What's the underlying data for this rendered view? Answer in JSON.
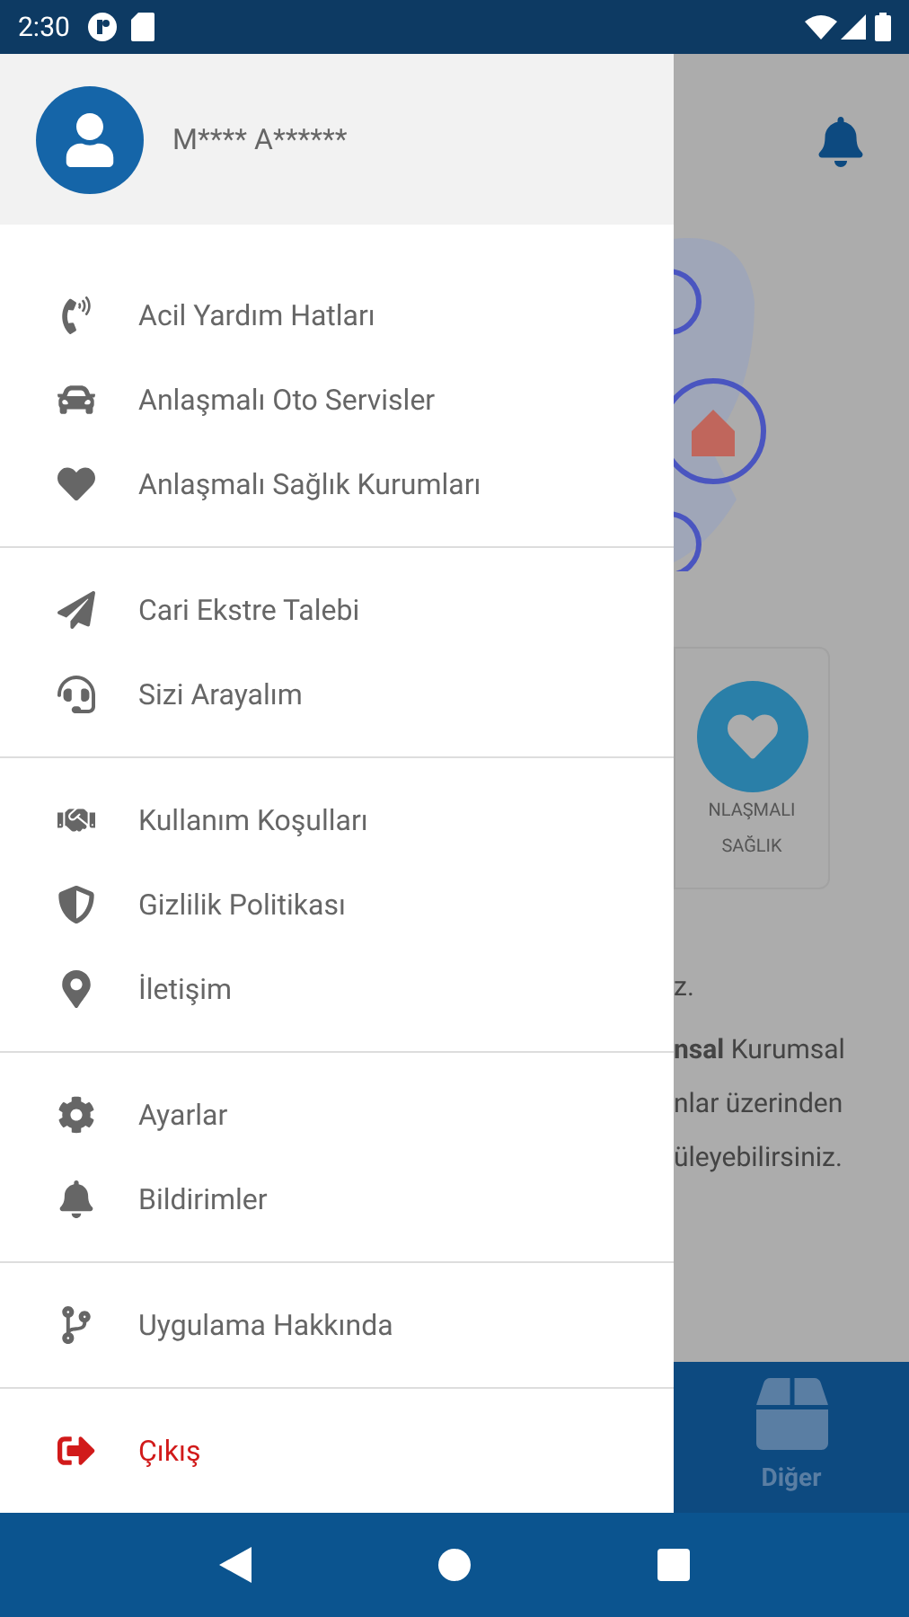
{
  "status_bar": {
    "time": "2:30"
  },
  "user": {
    "name": "M**** A******"
  },
  "menu_groups": [
    {
      "items": [
        {
          "label": "Acil Yardım Hatları",
          "kind": "normal"
        },
        {
          "label": "Anlaşmalı Oto Servisler",
          "kind": "normal"
        },
        {
          "label": "Anlaşmalı Sağlık Kurumları",
          "kind": "normal"
        }
      ]
    },
    {
      "items": [
        {
          "label": "Cari Ekstre Talebi",
          "kind": "normal"
        },
        {
          "label": "Sizi Arayalım",
          "kind": "normal"
        }
      ]
    },
    {
      "items": [
        {
          "label": "Kullanım Koşulları",
          "kind": "normal"
        },
        {
          "label": "Gizlilik Politikası",
          "kind": "normal"
        },
        {
          "label": "İletişim",
          "kind": "normal"
        }
      ]
    },
    {
      "items": [
        {
          "label": "Ayarlar",
          "kind": "normal"
        },
        {
          "label": "Bildirimler",
          "kind": "normal"
        }
      ]
    },
    {
      "items": [
        {
          "label": "Uygulama Hakkında",
          "kind": "normal"
        }
      ]
    },
    {
      "items": [
        {
          "label": "Çıkış",
          "kind": "logout"
        }
      ]
    }
  ],
  "background": {
    "card_label": [
      "NLAŞMALI",
      "SAĞLIK"
    ],
    "text_lines": [
      "z.",
      "**nsal** Kurumsal",
      "nlar üzerinden",
      "üleyebilirsiniz."
    ],
    "tab_label": "Diğer"
  }
}
